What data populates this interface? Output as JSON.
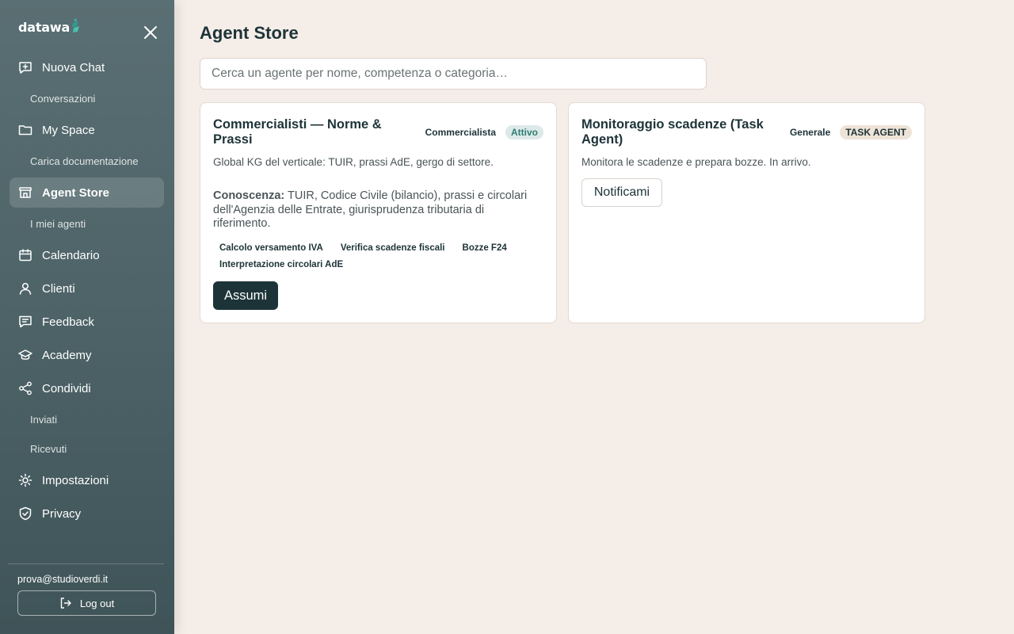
{
  "app": {
    "logo_text": "datawa"
  },
  "sidebar": {
    "items": [
      {
        "type": "item",
        "label": "Nuova Chat",
        "icon": "chat-plus-icon"
      },
      {
        "type": "sub",
        "label": "Conversazioni"
      },
      {
        "type": "item",
        "label": "My Space",
        "icon": "folder-icon"
      },
      {
        "type": "sub",
        "label": "Carica documentazione"
      },
      {
        "type": "item",
        "label": "Agent Store",
        "icon": "store-icon",
        "active": true
      },
      {
        "type": "sub",
        "label": "I miei agenti"
      },
      {
        "type": "item",
        "label": "Calendario",
        "icon": "calendar-icon"
      },
      {
        "type": "item",
        "label": "Clienti",
        "icon": "user-icon"
      },
      {
        "type": "item",
        "label": "Feedback",
        "icon": "feedback-icon"
      },
      {
        "type": "item",
        "label": "Academy",
        "icon": "graduation-cap-icon"
      },
      {
        "type": "item",
        "label": "Condividi",
        "icon": "share-icon"
      },
      {
        "type": "sub",
        "label": "Inviati"
      },
      {
        "type": "sub",
        "label": "Ricevuti"
      },
      {
        "type": "item",
        "label": "Impostazioni",
        "icon": "sun-settings-icon"
      },
      {
        "type": "item",
        "label": "Privacy",
        "icon": "shield-check-icon"
      }
    ],
    "user_email": "prova@studioverdi.it",
    "logout_label": "Log out"
  },
  "main": {
    "title": "Agent Store",
    "search_placeholder": "Cerca un agente per nome, competenza o categoria…",
    "cards": [
      {
        "title": "Commercialisti — Norme & Prassi",
        "category": "Commercialista",
        "status": "Attivo",
        "description": "Global KG del verticale: TUIR, prassi AdE, gergo di settore.",
        "knowledge_label": "Conoscenza:",
        "knowledge_text": " TUIR, Codice Civile (bilancio), prassi e circolari dell'Agenzia delle Entrate, giurisprudenza tributaria di riferimento.",
        "skills": [
          "Calcolo versamento IVA",
          "Verifica scadenze fiscali",
          "Bozze F24",
          "Interpretazione circolari AdE"
        ],
        "action_label": "Assumi"
      },
      {
        "title": "Monitoraggio scadenze (Task Agent)",
        "category": "Generale",
        "status": "TASK AGENT",
        "description": "Monitora le scadenze e prepara bozze. In arrivo.",
        "action_label": "Notificami"
      }
    ]
  },
  "colors": {
    "sidebar_bg": "#4d6367",
    "page_bg": "#f5ede7",
    "primary_dark": "#1c3438",
    "logo_accent": "#3fb3a5",
    "active_pill_bg": "#dde9e8",
    "active_pill_text": "#2f7d74",
    "task_pill_bg": "#ede3d6"
  }
}
